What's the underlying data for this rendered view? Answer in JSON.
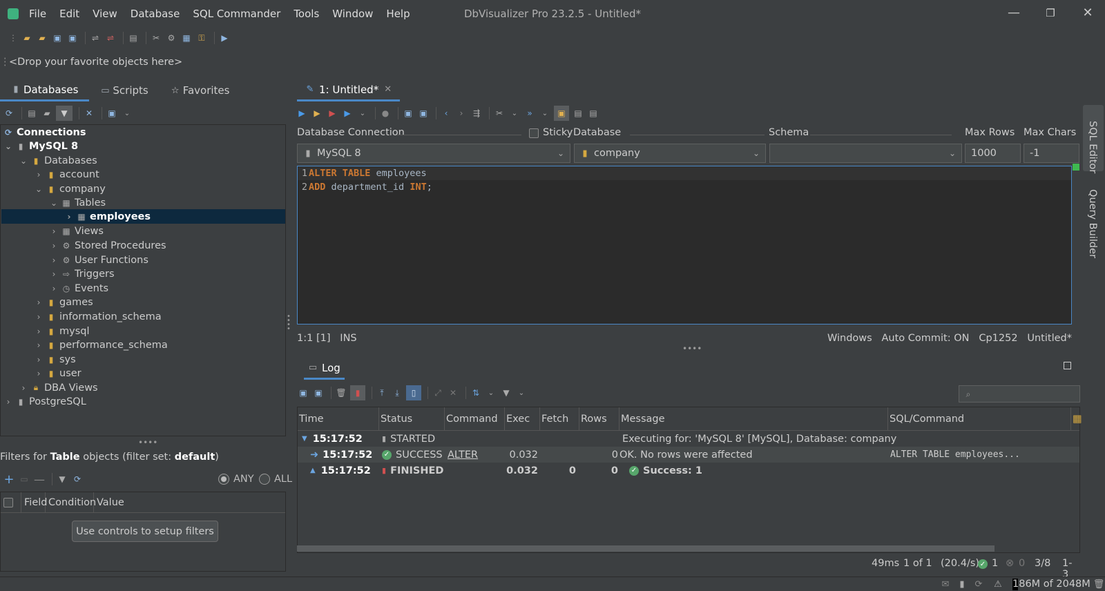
{
  "window": {
    "title": "DbVisualizer Pro 23.2.5 - Untitled*",
    "minimize": "—",
    "restore": "❐",
    "close": "✕"
  },
  "menu": [
    "File",
    "Edit",
    "View",
    "Database",
    "SQL Commander",
    "Tools",
    "Window",
    "Help"
  ],
  "favorites_bar": "<Drop your favorite objects here>",
  "left_tabs": {
    "databases": "Databases",
    "scripts": "Scripts",
    "favorites": "Favorites"
  },
  "tree": {
    "connections": "Connections",
    "mysql": "MySQL 8",
    "databases": "Databases",
    "account": "account",
    "company": "company",
    "tables": "Tables",
    "employees": "employees",
    "views": "Views",
    "stored_procedures": "Stored Procedures",
    "user_functions": "User Functions",
    "triggers": "Triggers",
    "events": "Events",
    "games": "games",
    "information_schema": "information_schema",
    "mysql_db": "mysql",
    "performance_schema": "performance_schema",
    "sys": "sys",
    "user": "user",
    "dba_views": "DBA Views",
    "postgresql": "PostgreSQL"
  },
  "filters": {
    "prefix": "Filters for ",
    "object": "Table",
    "middle": " objects (filter set: ",
    "set": "default",
    "suffix": ")",
    "any": "ANY",
    "all": "ALL",
    "col_field": "Field",
    "col_condition": "Condition",
    "col_value": "Value",
    "setup_button": "Use controls to setup filters"
  },
  "editor": {
    "tab_label": "1: Untitled*",
    "tab_close": "✕",
    "label_connection": "Database Connection",
    "label_sticky": "Sticky",
    "label_database": "Database",
    "label_schema": "Schema",
    "label_max_rows": "Max Rows",
    "label_max_chars": "Max Chars",
    "connection_value": "MySQL 8",
    "database_value": "company",
    "schema_value": "",
    "max_rows": "1000",
    "max_chars": "-1",
    "lines": [
      {
        "num": "1",
        "kw1": "ALTER TABLE",
        "rest": " employees",
        "kw2": "",
        "end": ""
      },
      {
        "num": "2",
        "kw1": "ADD",
        "rest": " department_id ",
        "kw2": "INT",
        "end": ";"
      }
    ],
    "status_left": "1:1 [1]   INS",
    "status_right": "Windows   Auto Commit: ON   Cp1252   Untitled*"
  },
  "side_tabs": {
    "sql_editor": "SQL Editor",
    "query_builder": "Query Builder"
  },
  "log": {
    "tab_label": "Log",
    "columns": [
      "Time",
      "Status",
      "Command",
      "Exec",
      "Fetch",
      "Rows",
      "Message",
      "SQL/Command"
    ],
    "rows": [
      {
        "time": "15:17:52",
        "status": "STARTED",
        "command": "",
        "exec": "",
        "fetch": "",
        "rows": "",
        "message": "Executing for: 'MySQL 8' [MySQL], Database: company",
        "sql": ""
      },
      {
        "time": "15:17:52",
        "status": "SUCCESS",
        "command": "ALTER",
        "exec": "0.032",
        "fetch": "",
        "rows": "0",
        "message": "OK. No rows were affected",
        "sql": "ALTER TABLE employees..."
      },
      {
        "time": "15:17:52",
        "status": "FINISHED",
        "command": "",
        "exec": "0.032",
        "fetch": "0",
        "rows": "0",
        "message": "Success: 1",
        "sql": ""
      }
    ]
  },
  "bottom_status": {
    "time": "49ms",
    "page": "1 of 1",
    "rate": "(20.4/s)",
    "success": "1",
    "errors": "0",
    "position": "3/8",
    "range": "1-3"
  },
  "memory": "186M of 2048M",
  "colors": {
    "accent": "#4a88c7",
    "keyword": "#cc7832",
    "success": "#57a66b",
    "selection": "#0d293e"
  }
}
